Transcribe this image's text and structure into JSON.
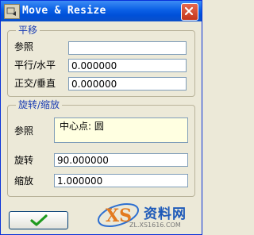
{
  "window": {
    "title": "Move & Resize"
  },
  "translate_group": {
    "title": "平移",
    "reference_label": "参照",
    "reference_value": "",
    "parallel_label": "平行/水平",
    "parallel_value": "0.000000",
    "normal_label": "正交/垂直",
    "normal_value": "0.000000"
  },
  "rotate_group": {
    "title": "旋转/缩放",
    "reference_label": "参照",
    "reference_value": "中心点: 圆",
    "rotate_label": "旋转",
    "rotate_value": "90.000000",
    "scale_label": "缩放",
    "scale_value": "1.000000"
  },
  "buttons": {
    "ok_icon": "checkmark-icon"
  },
  "watermark": {
    "brand": "资料网",
    "url": "ZL.XS1616.COM"
  },
  "colors": {
    "titlebar": "#0a5fe5",
    "group_title": "#1c3eb3",
    "dialog_bg": "#ece9d8",
    "note_bg": "#ffffe1",
    "check": "#1f9a1f"
  }
}
